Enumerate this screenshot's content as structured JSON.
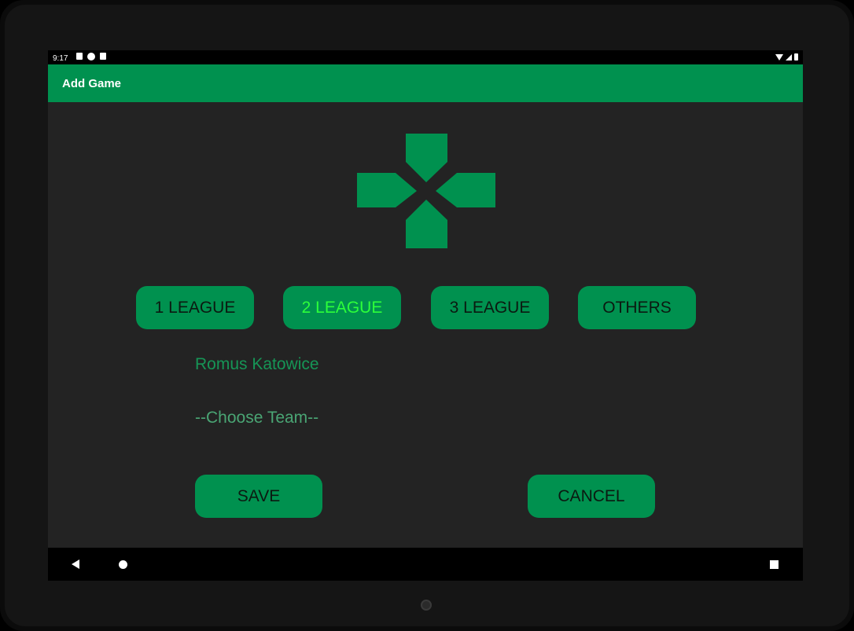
{
  "status_bar": {
    "time": "9:17",
    "left_icons": [
      "notification-a-icon",
      "notification-p-icon",
      "sd-card-icon"
    ],
    "right_icons": [
      "wifi-icon",
      "signal-icon",
      "battery-icon"
    ]
  },
  "app_bar": {
    "title": "Add Game",
    "color": "#00914f"
  },
  "logo": {
    "icon": "gamepad-dpad-icon",
    "color": "#00914f"
  },
  "league_buttons": [
    {
      "label": "1 LEAGUE",
      "selected": false
    },
    {
      "label": "2 LEAGUE",
      "selected": true
    },
    {
      "label": "3 LEAGUE",
      "selected": false
    },
    {
      "label": "OTHERS",
      "selected": false
    }
  ],
  "teams": {
    "home_team": "Romus Katowice",
    "away_team_placeholder": "--Choose Team--"
  },
  "actions": {
    "save": "SAVE",
    "cancel": "CANCEL"
  },
  "colors": {
    "accent": "#00914f",
    "selected_text": "#2cff3a",
    "background": "#232323"
  },
  "nav_bar": {
    "icons": [
      "back-icon",
      "home-icon",
      "recents-icon"
    ]
  }
}
